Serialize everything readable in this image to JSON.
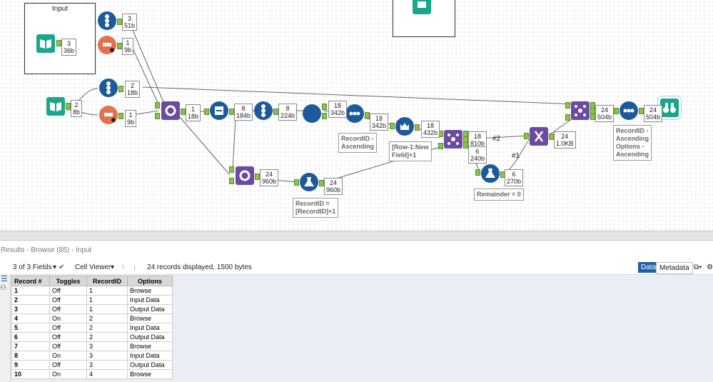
{
  "containers": {
    "input_title": "Input"
  },
  "badges": {
    "b1": "3\n51b",
    "b2": "3\n36b",
    "b3": "1\n9b",
    "b4": "2\n18b",
    "b5": "2\n8b",
    "b6": "1\n9b",
    "b7": "1\n18b",
    "b8": "8\n184b",
    "b9": "8\n224b",
    "b10": "18\n342b",
    "b11": "18\n342b",
    "b12": "18\n432b",
    "b13": "18\n810b",
    "b14": "6\n240b",
    "b15": "6\n270b",
    "b16": "24\n1.0KB",
    "b17": "24\n504b",
    "b18": "24\n504b",
    "b19": "24\n960b",
    "b20": "24\n960b"
  },
  "annotations": {
    "a1": "RecordID -\nAscending",
    "a2": "[Row-1:New\nField]+1",
    "a3": "Remainder = 0",
    "a4": "RecordID =\n[RecordID]+1",
    "a5": "RecordID -\nAscending\nOptions -\nAscending"
  },
  "conn_labels": {
    "c1": "#2",
    "c2": "#1"
  },
  "results": {
    "header": "Results - Browse (85) - Input",
    "fields": "3 of 3 Fields",
    "viewer": "Cell Viewer",
    "summary": "24 records displayed, 1500 bytes",
    "data_tab": "Data",
    "metadata_tab": "Metadata",
    "columns": [
      "Record #",
      "Toggles",
      "RecordID",
      "Options"
    ],
    "rows": [
      [
        "1",
        "Off",
        "1",
        "Browse"
      ],
      [
        "2",
        "Off",
        "1",
        "Input Data"
      ],
      [
        "3",
        "Off",
        "1",
        "Output Data"
      ],
      [
        "4",
        "On",
        "2",
        "Browse"
      ],
      [
        "5",
        "Off",
        "2",
        "Input Data"
      ],
      [
        "6",
        "Off",
        "2",
        "Output Data"
      ],
      [
        "7",
        "Off",
        "3",
        "Browse"
      ],
      [
        "8",
        "On",
        "3",
        "Input Data"
      ],
      [
        "9",
        "Off",
        "3",
        "Output Data"
      ],
      [
        "10",
        "On",
        "4",
        "Browse"
      ]
    ]
  },
  "colors": {
    "teal": "#1aa58c",
    "navy": "#1c5a9c",
    "purple": "#6b4ba1",
    "orange": "#e4704c",
    "accent": "#1f5fa8"
  }
}
